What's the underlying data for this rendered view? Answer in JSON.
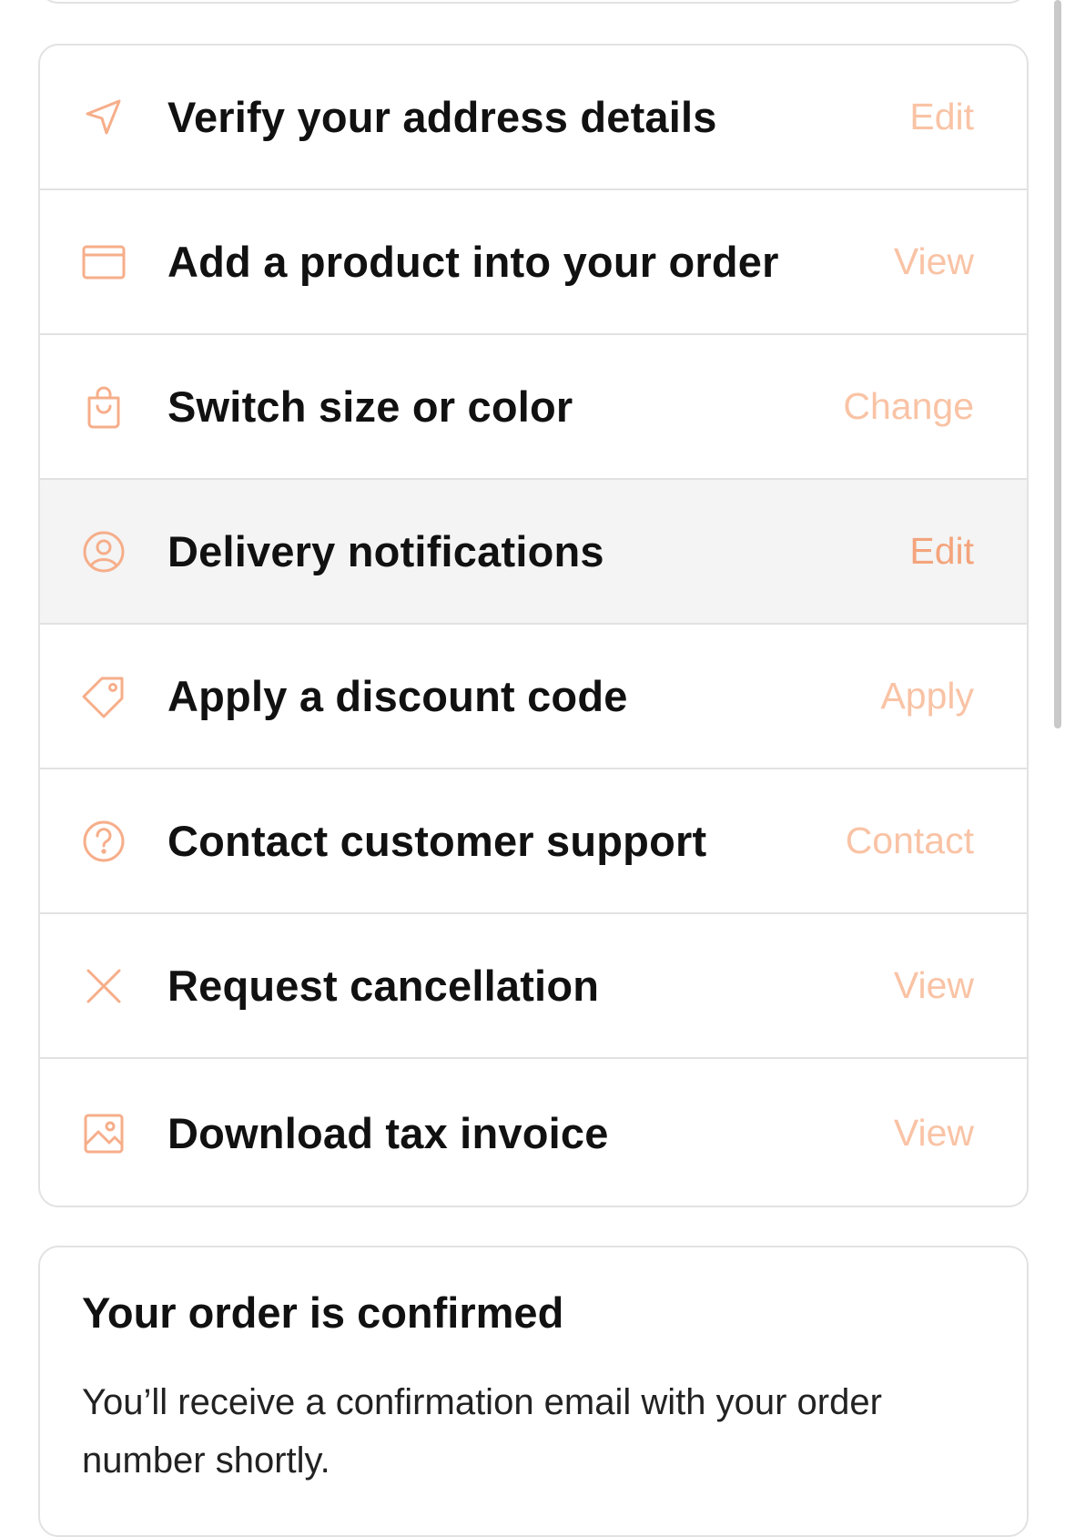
{
  "colors": {
    "accent": "#f4a47c",
    "accent_light": "#f9c3a5",
    "border": "#e2e2e2",
    "highlight_row": "#f4f4f4"
  },
  "actions": [
    {
      "label": "Verify your address details",
      "link": "Edit",
      "icon": "navigation-arrow-icon"
    },
    {
      "label": "Add a product into your order",
      "link": "View",
      "icon": "card-icon"
    },
    {
      "label": "Switch size or color",
      "link": "Change",
      "icon": "shopping-bag-icon"
    },
    {
      "label": "Delivery notifications",
      "link": "Edit",
      "icon": "user-circle-icon",
      "highlighted": true
    },
    {
      "label": "Apply a discount code",
      "link": "Apply",
      "icon": "tag-icon"
    },
    {
      "label": "Contact customer support",
      "link": "Contact",
      "icon": "question-circle-icon"
    },
    {
      "label": "Request cancellation",
      "link": "View",
      "icon": "close-icon"
    },
    {
      "label": "Download tax invoice",
      "link": "View",
      "icon": "image-icon"
    }
  ],
  "confirmation": {
    "title": "Your order is confirmed",
    "body": "You’ll receive a confirmation email with your order number shortly."
  }
}
